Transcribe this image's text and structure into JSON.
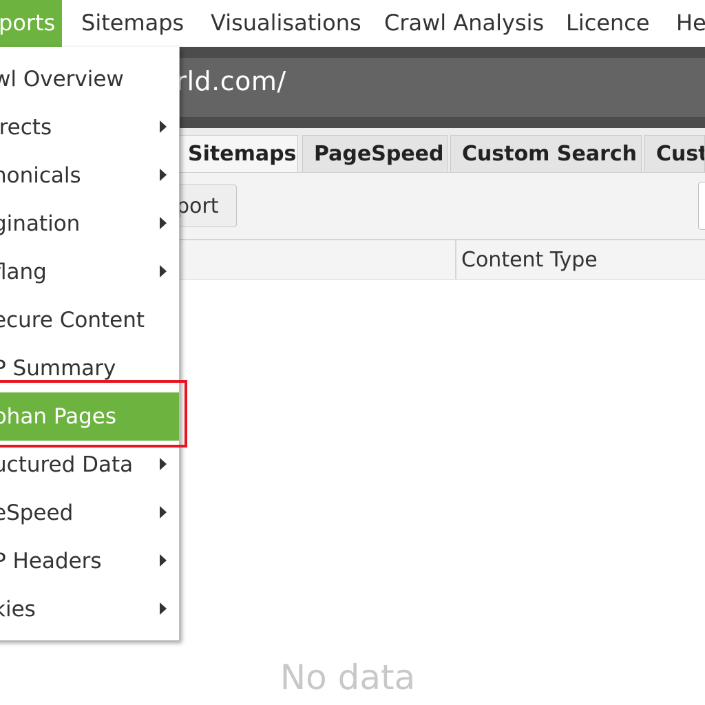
{
  "menubar": {
    "items": [
      {
        "label": "ports"
      },
      {
        "label": "Sitemaps"
      },
      {
        "label": "Visualisations"
      },
      {
        "label": "Crawl Analysis"
      },
      {
        "label": "Licence"
      },
      {
        "label": "He"
      }
    ]
  },
  "urlbar": {
    "text": "world.com/"
  },
  "tabs": [
    {
      "label": "Sitemaps"
    },
    {
      "label": "PageSpeed"
    },
    {
      "label": "Custom Search"
    },
    {
      "label": "Cust"
    }
  ],
  "toolbar": {
    "export_label": "port"
  },
  "table": {
    "columns": [
      {
        "label": "Content Type"
      }
    ],
    "empty_text": "No data"
  },
  "dropdown": {
    "items": [
      {
        "label": "wl Overview",
        "submenu": false
      },
      {
        "label": "irects",
        "submenu": true
      },
      {
        "label": "nonicals",
        "submenu": true
      },
      {
        "label": "gination",
        "submenu": true
      },
      {
        "label": "flang",
        "submenu": true
      },
      {
        "label": "ecure Content",
        "submenu": false
      },
      {
        "label": "P Summary",
        "submenu": false
      },
      {
        "label": "phan Pages",
        "submenu": false,
        "highlighted": true
      },
      {
        "label": "uctured Data",
        "submenu": true
      },
      {
        "label": "eSpeed",
        "submenu": true
      },
      {
        "label": "P Headers",
        "submenu": true
      },
      {
        "label": "kies",
        "submenu": true
      }
    ]
  },
  "colors": {
    "accent_green": "#6db33f",
    "highlight_border": "#e8151f",
    "urlbar_dark": "#4c4c4c"
  }
}
